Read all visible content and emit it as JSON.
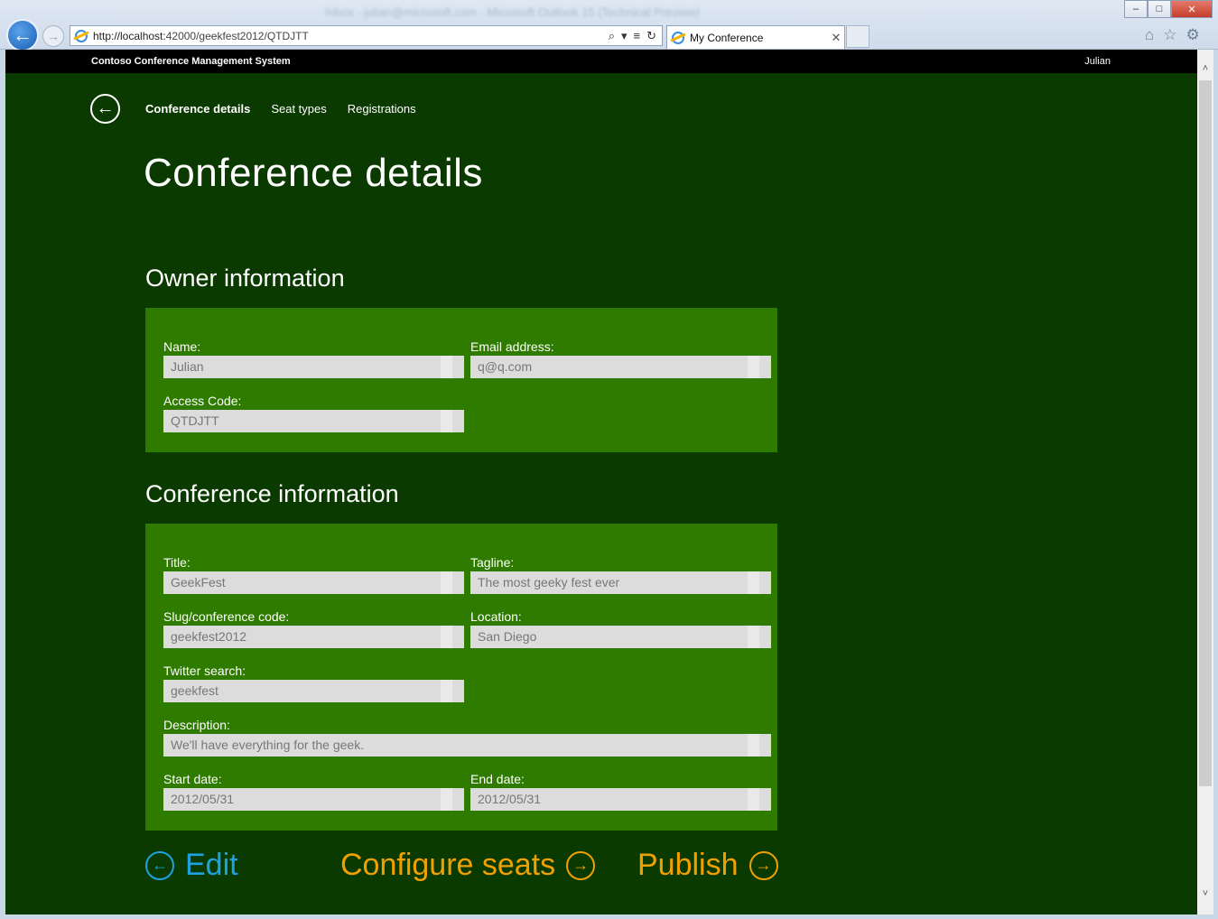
{
  "browser": {
    "window_title": "Inbox - julian@microsoft.com - Microsoft Outlook 15 (Technical Preview)",
    "url_host": "http://localhost:",
    "url_rest": "42000/geekfest2012/QTDJTT",
    "tab_title": "My Conference",
    "min": "–",
    "max": "□",
    "close": "✕",
    "back_icon": "←",
    "fwd_icon": "→",
    "search_icon": "⌕",
    "dropdown_icon": "▾",
    "compat_icon": "≡",
    "refresh_icon": "↻",
    "tab_close_icon": "✕",
    "home_icon": "⌂",
    "favorites_icon": "☆",
    "tools_icon": "⚙",
    "scroll_up_icon": "˄",
    "scroll_down_icon": "˅"
  },
  "header": {
    "brand": "Contoso Conference Management System",
    "user": "Julian"
  },
  "subnav": {
    "back_icon": "←",
    "items": [
      "Conference details",
      "Seat types",
      "Registrations"
    ]
  },
  "page_title": "Conference details",
  "owner": {
    "section_title": "Owner information",
    "name_label": "Name:",
    "name_value": "Julian",
    "email_label": "Email address:",
    "email_value": "q@q.com",
    "access_label": "Access Code:",
    "access_value": "QTDJTT"
  },
  "conference": {
    "section_title": "Conference information",
    "title_label": "Title:",
    "title_value": "GeekFest",
    "tagline_label": "Tagline:",
    "tagline_value": "The most geeky fest ever",
    "slug_label": "Slug/conference code:",
    "slug_value": "geekfest2012",
    "location_label": "Location:",
    "location_value": "San Diego",
    "twitter_label": "Twitter search:",
    "twitter_value": "geekfest",
    "description_label": "Description:",
    "description_value": "We'll have everything for the geek.",
    "start_label": "Start date:",
    "start_value": "2012/05/31",
    "end_label": "End date:",
    "end_value": "2012/05/31"
  },
  "actions": {
    "edit_label": "Edit",
    "edit_icon": "←",
    "configure_label": "Configure seats",
    "configure_icon": "→",
    "publish_label": "Publish",
    "publish_icon": "→"
  },
  "colors": {
    "page_bg": "#0b3a00",
    "panel_bg": "#2e7b00",
    "edit_accent": "#1fa1e0",
    "action_accent": "#f0a000"
  }
}
